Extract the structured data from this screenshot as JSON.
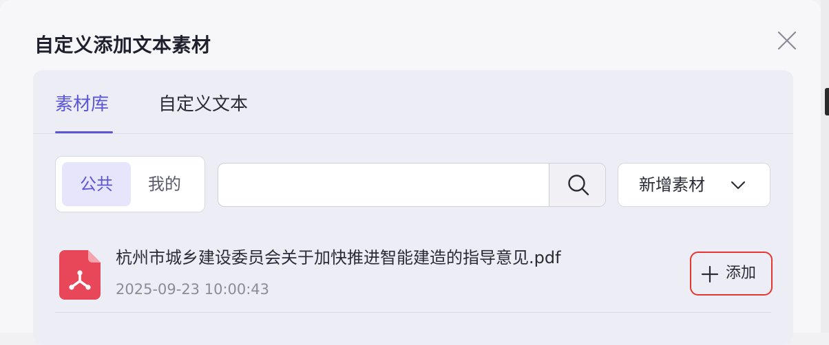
{
  "dialog": {
    "title": "自定义添加文本素材"
  },
  "tabs": [
    {
      "label": "素材库",
      "active": true
    },
    {
      "label": "自定义文本",
      "active": false
    }
  ],
  "scope": {
    "options": [
      "公共",
      "我的"
    ],
    "selected": "公共"
  },
  "search": {
    "value": "",
    "placeholder": ""
  },
  "toolbar": {
    "add_material_label": "新增素材"
  },
  "materials": [
    {
      "name": "杭州市城乡建设委员会关于加快推进智能建造的指导意见.pdf",
      "time": "2025-09-23 10:00:43",
      "type_icon": "pdf-icon",
      "action_label": "添加"
    }
  ],
  "colors": {
    "accent": "#5a56d6",
    "pdf": "#e8475a",
    "highlight": "#e5352e"
  }
}
